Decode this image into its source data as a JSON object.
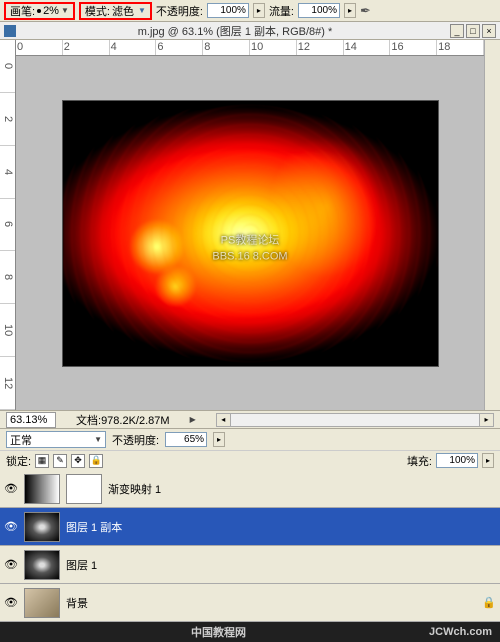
{
  "toolbar": {
    "brush_label": "画笔:",
    "brush_size": "2%",
    "mode_label": "模式:",
    "mode_value": "滤色",
    "opacity_label": "不透明度:",
    "opacity_value": "100%",
    "flow_label": "流量:",
    "flow_value": "100%"
  },
  "document": {
    "title": "m.jpg @ 63.1% (图层 1 副本, RGB/8#) *",
    "watermark_line1": "PS教程论坛",
    "watermark_line2": "BBS.16    8.COM"
  },
  "ruler_h": [
    "0",
    "2",
    "4",
    "6",
    "8",
    "10",
    "12",
    "14",
    "16",
    "18"
  ],
  "ruler_v": [
    "0",
    "2",
    "4",
    "6",
    "8",
    "10",
    "12"
  ],
  "status": {
    "zoom": "63.13%",
    "docsize_label": "文档:",
    "docsize": "978.2K/2.87M"
  },
  "layers_panel": {
    "blend_mode": "正常",
    "opacity_label": "不透明度:",
    "opacity_value": "65%",
    "lock_label": "锁定:",
    "fill_label": "填充:",
    "fill_value": "100%"
  },
  "layers": [
    {
      "name": "渐变映射 1",
      "selected": false,
      "type": "adj"
    },
    {
      "name": "图层 1 副本",
      "selected": true,
      "type": "cloud"
    },
    {
      "name": "图层 1",
      "selected": false,
      "type": "cloud"
    },
    {
      "name": "背景",
      "selected": false,
      "type": "bg"
    }
  ],
  "footer": {
    "cn": "中国教程网",
    "url": "JCWch.com"
  }
}
